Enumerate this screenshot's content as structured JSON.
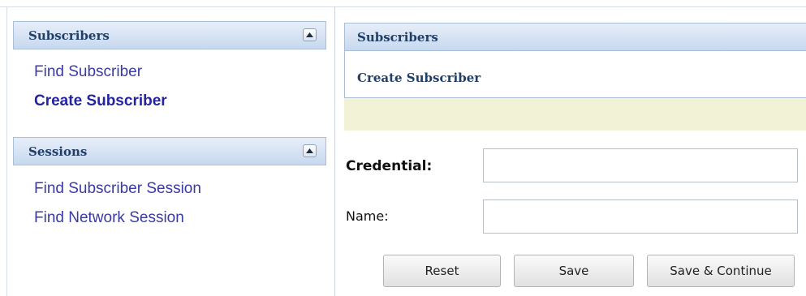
{
  "sidebar": {
    "panels": [
      {
        "title": "Subscribers",
        "items": [
          {
            "label": "Find Subscriber"
          },
          {
            "label": "Create Subscriber"
          }
        ]
      },
      {
        "title": "Sessions",
        "items": [
          {
            "label": "Find Subscriber Session"
          },
          {
            "label": "Find Network Session"
          }
        ]
      }
    ]
  },
  "main": {
    "header_title": "Subscribers",
    "subheader_title": "Create Subscriber",
    "form": {
      "credential_label": "Credential:",
      "credential_value": "",
      "name_label": "Name:",
      "name_value": ""
    },
    "buttons": {
      "reset": "Reset",
      "save": "Save",
      "save_continue": "Save & Continue"
    }
  },
  "colors": {
    "header_text": "#1f3f67",
    "link": "#3a3aa3",
    "message_bar": "#f1f2d6"
  },
  "icons": {
    "collapse": "chevron-up-icon"
  }
}
